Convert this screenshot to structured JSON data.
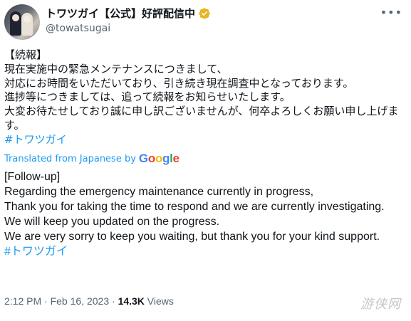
{
  "account": {
    "display_name": "トワツガイ【公式】好評配信中",
    "handle": "@towatsugai",
    "verified_icon": "verified-badge-gold",
    "more_icon": "more-options-icon"
  },
  "tweet": {
    "original_text": "【続報】\n現在実施中の緊急メンテナンスにつきまして、\n対応にお時間をいただいており、引き続き現在調査中となっております。\n進捗等につきましては、追って続報をお知らせいたします。\n大変お待たせしており誠に申し訳ございませんが、何卒よろしくお願い申し上げます。",
    "original_hashtag": "#トワツガイ",
    "translated_label": "Translated from Japanese by",
    "google_letters": [
      "G",
      "o",
      "o",
      "g",
      "l",
      "e"
    ],
    "translated_text": "[Follow-up]\nRegarding the emergency maintenance currently in progress,\nThank you for taking the time to respond and we are currently investigating.\nWe will keep you updated on the progress.\nWe are very sorry to keep you waiting, but thank you for your kind support.",
    "translated_hashtag": "#トワツガイ"
  },
  "meta": {
    "time": "2:12 PM",
    "separator": " · ",
    "date": "Feb 16, 2023",
    "views_count": "14.3K",
    "views_label": " Views"
  },
  "watermark": "游侠网",
  "colors": {
    "link": "#1d9bf0",
    "secondary": "#536471",
    "verified": "#f4b400"
  }
}
